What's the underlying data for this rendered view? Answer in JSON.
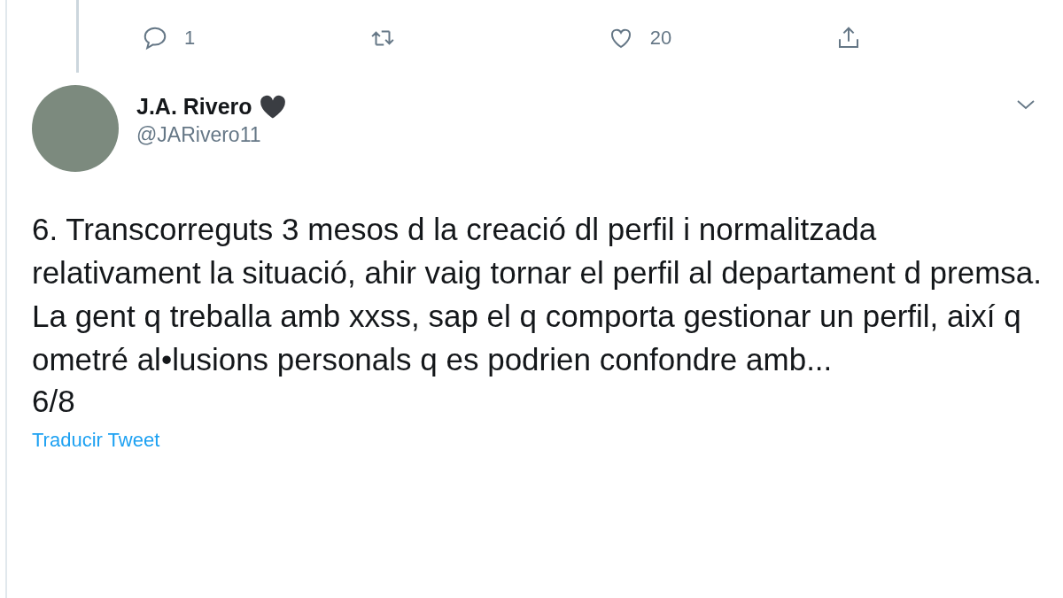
{
  "previous_tweet_actions": [
    {
      "kind": "reply",
      "count": "1"
    },
    {
      "kind": "retweet"
    },
    {
      "kind": "like",
      "count": "20"
    },
    {
      "kind": "share"
    }
  ],
  "tweet": {
    "author_name": "J.A. Rivero",
    "handle": "@JARivero11",
    "text": "6. Transcorreguts 3 mesos d la creació dl perfil i normalitzada relativament la situació, ahir vaig tornar el perfil al departament d premsa. La gent q treballa amb xxss, sap el q comporta gestionar un perfil, així q ometré al•lusions personals q es podrien confondre amb...",
    "thread_count": "6/8",
    "translate_link": "Traducir Tweet"
  }
}
